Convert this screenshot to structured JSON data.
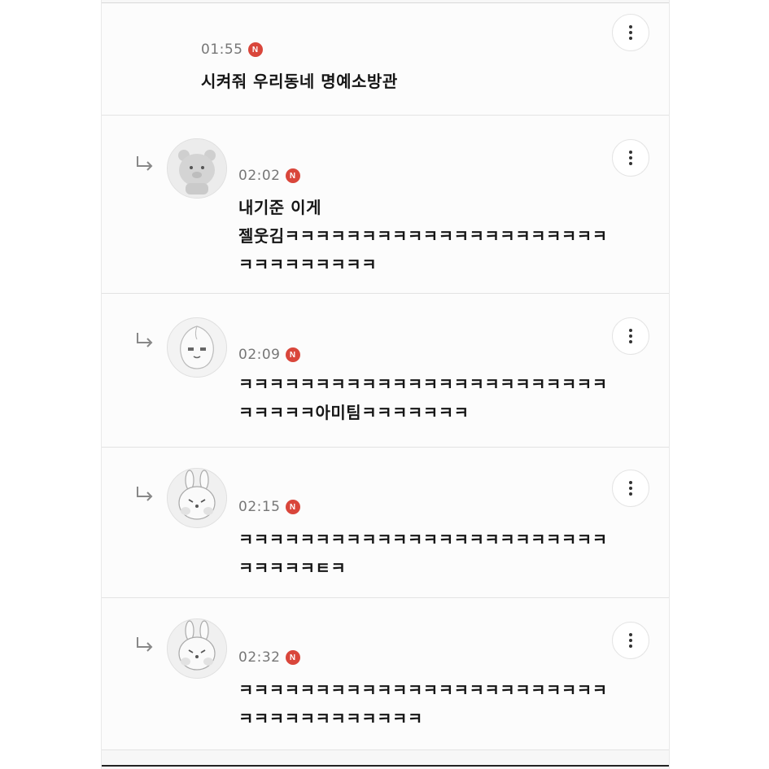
{
  "comments": [
    {
      "time": "01:55",
      "badge": "N",
      "lines": [
        "시켜줘 우리동네 명예소방관"
      ],
      "avatar_icon": "none",
      "more_icon": "more-vertical-icon"
    },
    {
      "time": "02:02",
      "badge": "N",
      "lines": [
        "내기준 이게",
        "젤웃김ㅋㅋㅋㅋㅋㅋㅋㅋㅋㅋㅋㅋㅋㅋㅋㅋㅋㅋㅋㅋㅋ",
        "ㅋㅋㅋㅋㅋㅋㅋㅋㅋ"
      ],
      "avatar_icon": "bear-avatar-icon",
      "more_icon": "more-vertical-icon"
    },
    {
      "time": "02:09",
      "badge": "N",
      "lines": [
        "ㅋㅋㅋㅋㅋㅋㅋㅋㅋㅋㅋㅋㅋㅋㅋㅋㅋㅋㅋㅋㅋㅋㅋㅋ",
        "ㅋㅋㅋㅋㅋ아미팀ㅋㅋㅋㅋㅋㅋㅋ"
      ],
      "avatar_icon": "peach-avatar-icon",
      "more_icon": "more-vertical-icon"
    },
    {
      "time": "02:15",
      "badge": "N",
      "lines": [
        "ㅋㅋㅋㅋㅋㅋㅋㅋㅋㅋㅋㅋㅋㅋㅋㅋㅋㅋㅋㅋㅋㅋㅋㅋ",
        "ㅋㅋㅋㅋㅋㅌㅋ"
      ],
      "avatar_icon": "rabbit-avatar-icon",
      "more_icon": "more-vertical-icon"
    },
    {
      "time": "02:32",
      "badge": "N",
      "lines": [
        "ㅋㅋㅋㅋㅋㅋㅋㅋㅋㅋㅋㅋㅋㅋㅋㅋㅋㅋㅋㅋㅋㅋㅋㅋ",
        "ㅋㅋㅋㅋㅋㅋㅋㅋㅋㅋㅋㅋ"
      ],
      "avatar_icon": "rabbit-avatar-icon",
      "more_icon": "more-vertical-icon"
    }
  ],
  "icons": {
    "reply": "reply-arrow-icon"
  },
  "colors": {
    "badge": "#d9463b",
    "time": "#777777",
    "text": "#161616",
    "background": "#f7f7f7"
  }
}
